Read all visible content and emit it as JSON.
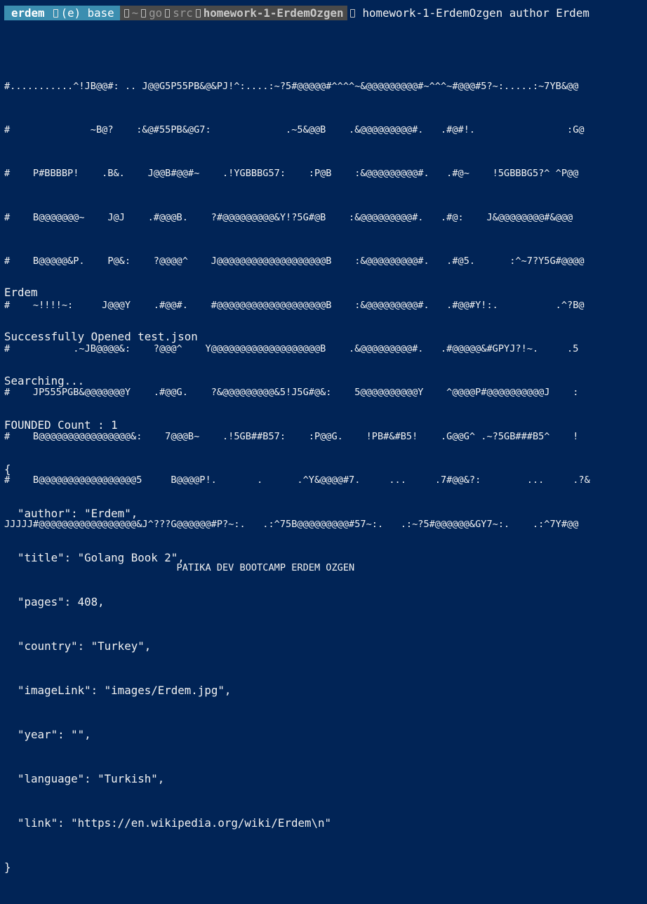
{
  "prompt": {
    "user": "erdem",
    "env": "(e) base",
    "path": {
      "home": "~",
      "segments": [
        "go",
        "src"
      ],
      "current": "homework-1-ErdemOzgen"
    },
    "command": "homework-1-ErdemOzgen author Erdem"
  },
  "ascii_art": [
    "#...........^!JB@@#: .. J@@G5P55PB&@&PJ!^:....:~?5#@@@@@#^^^^~&@@@@@@@@@#~^^^~#@@@#5?~:.....:~7YB&@@",
    "#              ~B@?    :&@#55PB&@G7:             .~5&@@B    .&@@@@@@@@@#.   .#@#!.                :G@",
    "#    P#BBBBP!    .B&.    J@@B#@@#~    .!YGBBBG57:    :P@B    :&@@@@@@@@@#.   .#@~    !5GBBBG5?^ ^P@@",
    "#    B@@@@@@@~    J@J    .#@@@B.    ?#@@@@@@@@@&Y!?5G#@B    :&@@@@@@@@@#.   .#@:    J&@@@@@@@@#&@@@",
    "#    B@@@@@&P.    P@&:    ?@@@@^    J@@@@@@@@@@@@@@@@@@@B    :&@@@@@@@@@#.   .#@5.      :^~7?Y5G#@@@@",
    "#    ~!!!!~:     J@@@Y    .#@@#.    #@@@@@@@@@@@@@@@@@@@B    :&@@@@@@@@@#.   .#@@#Y!:.          .^?B@",
    "#           .~JB@@@@&:    ?@@@^    Y@@@@@@@@@@@@@@@@@@@B    .&@@@@@@@@@#.   .#@@@@@&#GPYJ?!~.     .5",
    "#    JP555PGB&@@@@@@@Y    .#@@G.    ?&@@@@@@@@@&5!J5G#@&:    5@@@@@@@@@@Y    ^@@@@P#@@@@@@@@@@J    :",
    "#    B@@@@@@@@@@@@@@@@&:    7@@@B~    .!5GB##B57:    :P@@G.    !PB#&#B5!    .G@@G^ .~?5GB###B5^    !",
    "#    B@@@@@@@@@@@@@@@@@5     B@@@@P!.       .      .^Y&@@@@#7.     ...     .7#@@&?:        ...     .?&",
    "JJJJJ#@@@@@@@@@@@@@@@@@&J^???G@@@@@@#P?~:.   .:^75B@@@@@@@@@#57~:.   .:~?5#@@@@@@&GY7~:.    .:^7Y#@@",
    "                              PATIKA DEV BOOTCAMP ERDEM OZGEN"
  ],
  "output": [
    "Erdem",
    "Successfully Opened test.json",
    "Searching...",
    "FOUNDED Count : 1",
    "{",
    "  \"author\": \"Erdem\",",
    "  \"title\": \"Golang Book 2\",",
    "  \"pages\": 408,",
    "  \"country\": \"Turkey\",",
    "  \"imageLink\": \"images/Erdem.jpg\",",
    "  \"year\": \"\",",
    "  \"language\": \"Turkish\",",
    "  \"link\": \"https://en.wikipedia.org/wiki/Erdem\\n\"",
    "}"
  ],
  "colors": {
    "background": "#012456",
    "prompt_user_bg": "#3b8eb0",
    "prompt_path_bg": "#4a4a4a",
    "text": "#f2f2f2"
  },
  "icons": {
    "separator": "folder-separator-icon",
    "command_separator": "powerline-glyph-icon"
  }
}
